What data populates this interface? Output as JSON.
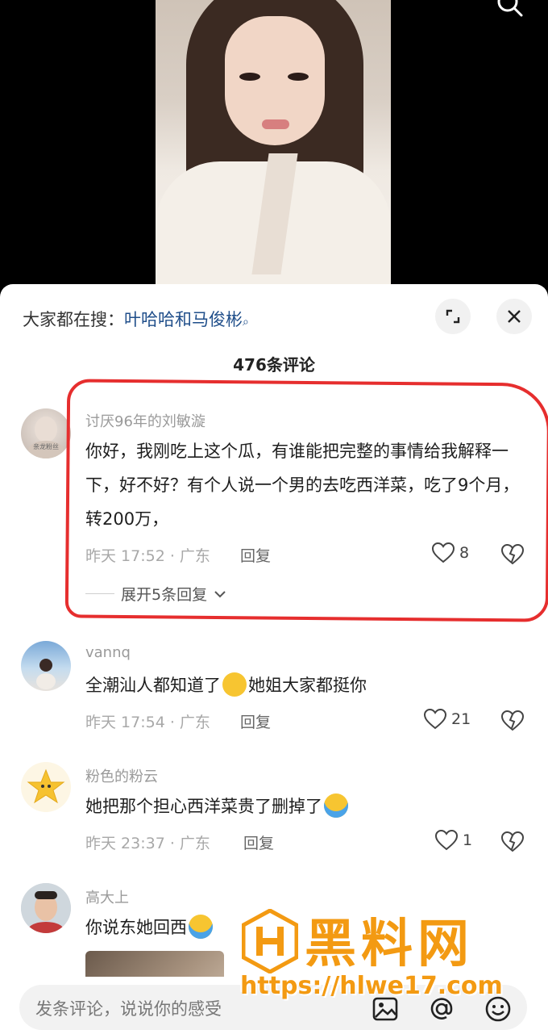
{
  "trending": {
    "prefix": "大家都在搜：",
    "keyword": "叶哈哈和马俊彬",
    "search_glyph": "⌕"
  },
  "comment_count": "476条评论",
  "comments": [
    {
      "username": "讨厌96年的刘敏漩",
      "text": "你好，我刚吃上这个瓜，有谁能把完整的事情给我解释一下，好不好？有个人说一个男的去吃西洋菜，吃了9个月，转200万，",
      "meta": "昨天 17:52 · 广东",
      "reply_label": "回复",
      "likes": "8",
      "expand_label": "展开5条回复",
      "avatar_text": "亲龙粉丝"
    },
    {
      "username": "vannq",
      "text_before": "全潮汕人都知道了",
      "text_after": "她姐大家都挺你",
      "meta": "昨天 17:54 · 广东",
      "reply_label": "回复",
      "likes": "21"
    },
    {
      "username": "粉色的粉云",
      "text": "她把那个担心西洋菜贵了删掉了",
      "meta": "昨天 23:37 · 广东",
      "reply_label": "回复",
      "likes": "1"
    },
    {
      "username": "高大上",
      "text": "你说东她回西"
    }
  ],
  "input": {
    "placeholder": "发条评论，说说你的感受"
  },
  "watermark": {
    "title": "黑料网",
    "url": "https://hlwe17.com"
  },
  "colors": {
    "link": "#1f4e8a",
    "annotation_red": "#e62e2e",
    "watermark_orange": "#f39a12"
  }
}
